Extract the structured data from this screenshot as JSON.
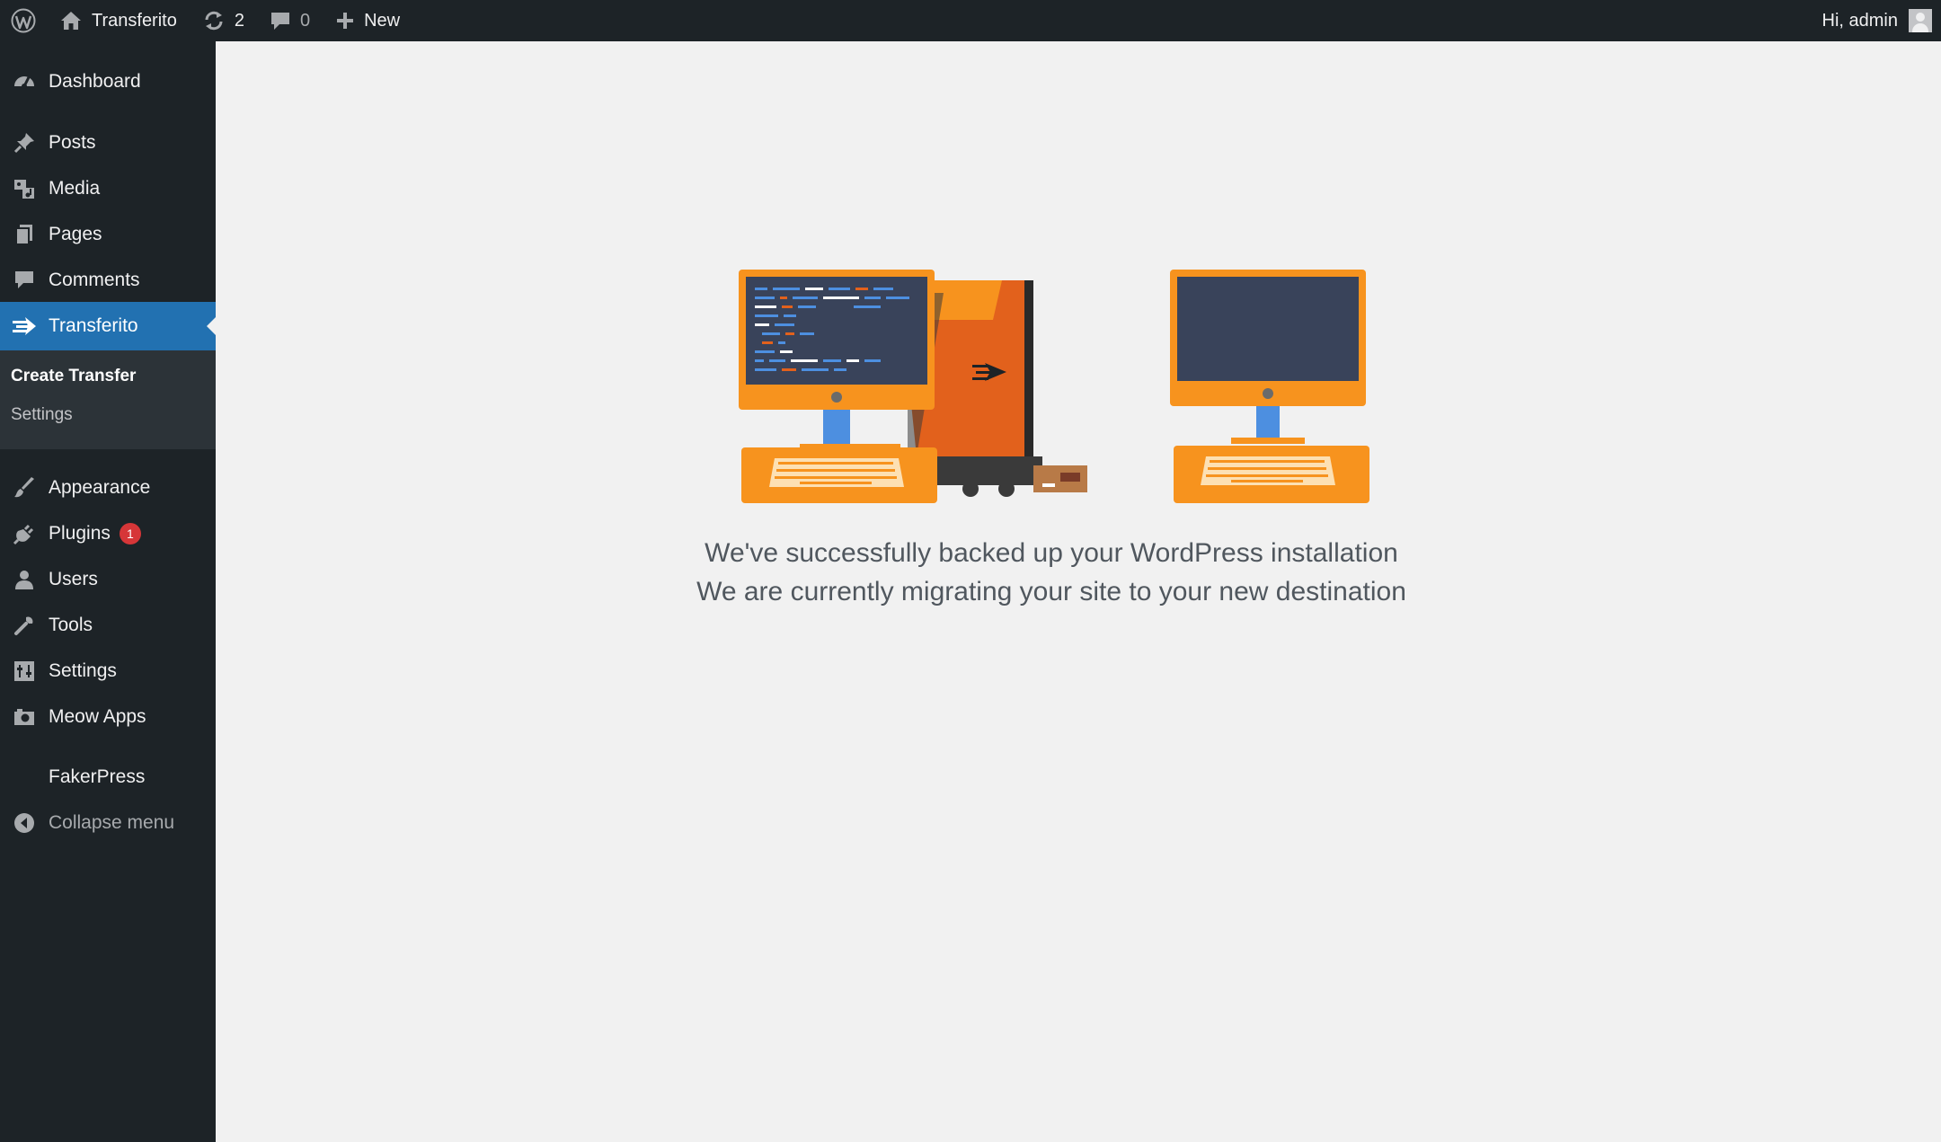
{
  "admin_bar": {
    "site_name": "Transferito",
    "updates_count": "2",
    "comments_count": "0",
    "new_label": "New",
    "greeting": "Hi, admin",
    "icons": {
      "logo": "wordpress-icon",
      "home": "home-icon",
      "updates": "refresh-icon",
      "comments": "comment-icon",
      "new": "plus-icon",
      "avatar": "user-avatar-icon"
    }
  },
  "sidebar": {
    "items": [
      {
        "label": "Dashboard",
        "icon": "dashboard-icon"
      },
      {
        "label": "Posts",
        "icon": "pin-icon"
      },
      {
        "label": "Media",
        "icon": "media-icon"
      },
      {
        "label": "Pages",
        "icon": "pages-icon"
      },
      {
        "label": "Comments",
        "icon": "comment-icon"
      },
      {
        "label": "Transferito",
        "icon": "transfer-arrow-icon",
        "current": true
      },
      {
        "label": "Appearance",
        "icon": "brush-icon"
      },
      {
        "label": "Plugins",
        "icon": "plugin-icon",
        "badge": "1"
      },
      {
        "label": "Users",
        "icon": "user-icon"
      },
      {
        "label": "Tools",
        "icon": "wrench-icon"
      },
      {
        "label": "Settings",
        "icon": "settings-icon"
      },
      {
        "label": "Meow Apps",
        "icon": "camera-icon"
      },
      {
        "label": "FakerPress",
        "icon": ""
      },
      {
        "label": "Collapse menu",
        "icon": "collapse-icon"
      }
    ],
    "submenu": {
      "items": [
        {
          "label": "Create Transfer",
          "current": true
        },
        {
          "label": "Settings"
        }
      ]
    }
  },
  "main": {
    "line1": "We've successfully backed up your WordPress installation",
    "line2": "We are currently migrating your site to your new destination"
  },
  "colors": {
    "admin_bar": "#1d2327",
    "sidebar": "#1d2327",
    "submenu": "#2c3338",
    "current": "#2271b1",
    "background": "#f1f1f1",
    "orange": "#f7931e",
    "orange_dark": "#e2611c",
    "screen": "#39435a"
  }
}
